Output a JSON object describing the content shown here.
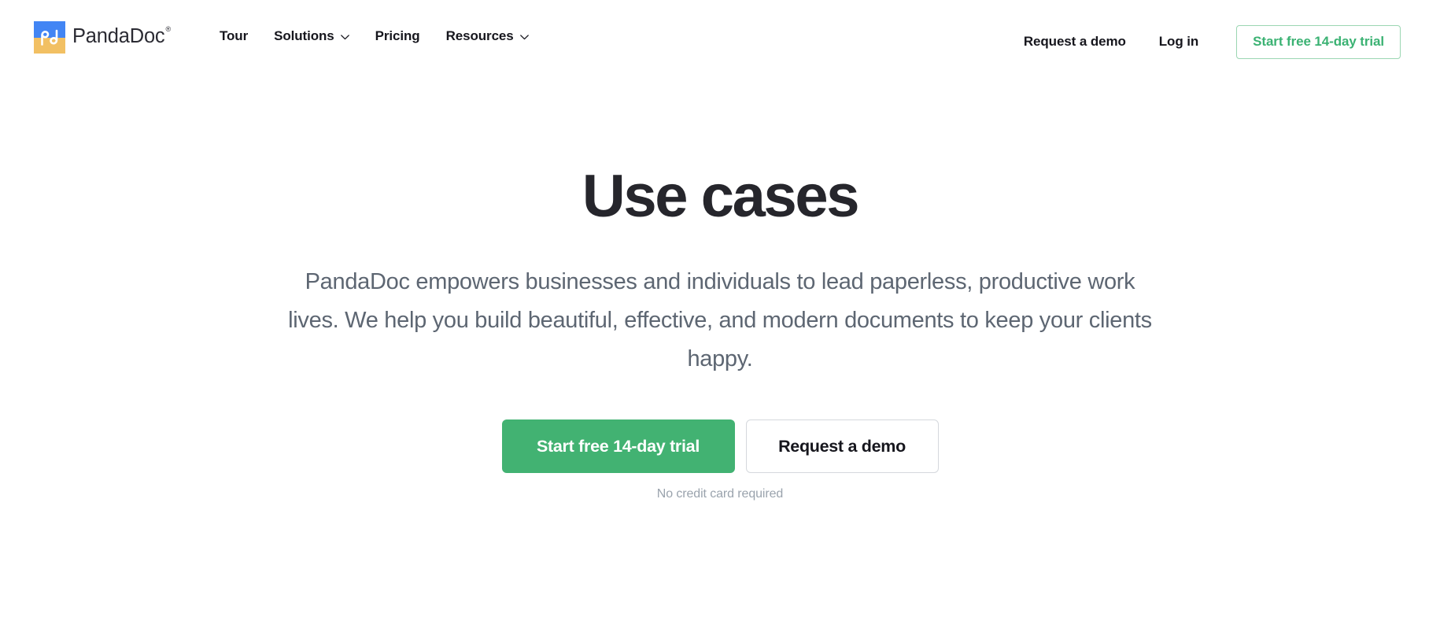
{
  "colors": {
    "brand_blue": "#4285f4",
    "brand_gold": "#f2c063",
    "accent_green": "#42b272",
    "accent_green_outline": "#3bb273",
    "heading": "#26262c",
    "body_text": "#5d6672",
    "muted": "#9aa3ad",
    "page_bg": "#ffffff"
  },
  "header": {
    "logo": {
      "icon_name": "pandadoc-logo-icon",
      "wordmark": "PandaDoc",
      "trademark": "®"
    },
    "nav": [
      {
        "label": "Tour",
        "has_dropdown": false
      },
      {
        "label": "Solutions",
        "has_dropdown": true
      },
      {
        "label": "Pricing",
        "has_dropdown": false
      },
      {
        "label": "Resources",
        "has_dropdown": true
      }
    ],
    "request_demo_label": "Request a demo",
    "login_label": "Log in",
    "trial_button_label": "Start free 14-day trial"
  },
  "hero": {
    "title": "Use cases",
    "subtitle_lines": [
      "PandaDoc empowers businesses and individuals to lead paperless,",
      "productive work lives. We help you build beautiful, effective, and modern",
      "documents to keep your clients happy."
    ],
    "subtitle": "PandaDoc empowers businesses and individuals to lead paperless, productive work lives. We help you build beautiful, effective, and modern documents to keep your clients happy.",
    "primary_cta": "Start free 14-day trial",
    "secondary_cta": "Request a demo",
    "note": "No credit card required"
  }
}
